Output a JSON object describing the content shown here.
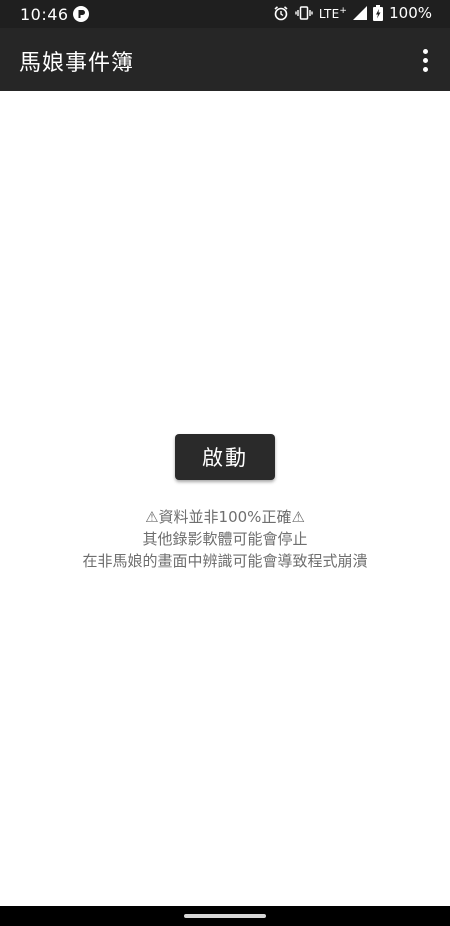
{
  "status_bar": {
    "time": "10:46",
    "network": "LTE",
    "network_plus": "+",
    "battery": "100%",
    "icons": [
      "app-notification-icon",
      "alarm-icon",
      "vibrate-icon",
      "signal-icon",
      "battery-charging-icon"
    ]
  },
  "app_bar": {
    "title": "馬娘事件簿",
    "overflow_icon": "more-vert-icon"
  },
  "main": {
    "start_label": "啟動",
    "notice_lines": [
      "⚠資料並非100%正確⚠",
      "其他錄影軟體可能會停止",
      "在非馬娘的畫面中辨識可能會導致程式崩潰"
    ]
  },
  "colors": {
    "status_bar": "#1f1f1f",
    "app_bar": "#262626",
    "button": "#2a2a2a",
    "notice_text": "#6f6f6f"
  }
}
